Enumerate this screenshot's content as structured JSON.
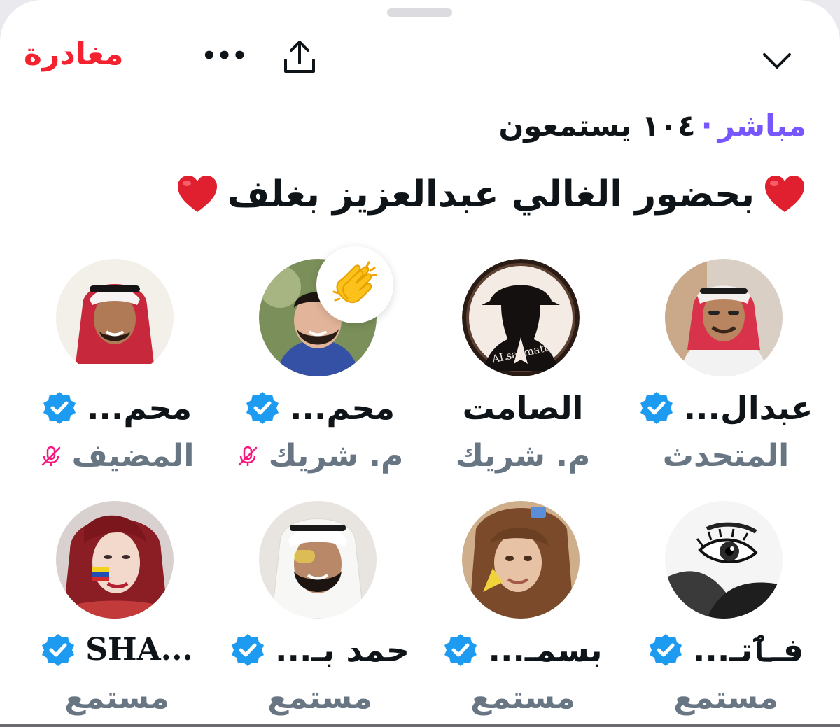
{
  "header": {
    "leave_label": "مغادرة",
    "more_label": "•••",
    "share_icon": "share-icon",
    "collapse_icon": "chevron-down-icon"
  },
  "space": {
    "live_label": "مباشر",
    "listeners_label": "١٠٤ يستمعون",
    "title": "بحضور الغالي عبدالعزيز بغلف",
    "title_icon": "red-heart"
  },
  "participants": [
    {
      "name": "عبدال...",
      "role": "المتحدث",
      "verified": true,
      "muted": false,
      "reaction": ""
    },
    {
      "name": "الصامت",
      "role": "م. شريك",
      "verified": false,
      "muted": false,
      "reaction": "",
      "avatar_text": "ALsaamatt"
    },
    {
      "name": "محم...",
      "role": "م. شريك",
      "verified": true,
      "muted": true,
      "reaction": "clapping-hands"
    },
    {
      "name": "محم...",
      "role": "المضيف",
      "verified": true,
      "muted": true,
      "reaction": ""
    },
    {
      "name": "فـٱتـ...",
      "role": "مستمع",
      "verified": true,
      "muted": false,
      "reaction": ""
    },
    {
      "name": "بسمـ...",
      "role": "مستمع",
      "verified": true,
      "muted": false,
      "reaction": ""
    },
    {
      "name": "حمد بـ...",
      "role": "مستمع",
      "verified": true,
      "muted": false,
      "reaction": ""
    },
    {
      "name": "SHA...",
      "role": "مستمع",
      "verified": true,
      "muted": false,
      "reaction": ""
    }
  ],
  "colors": {
    "leave": "#f4212e",
    "live": "#7856ff",
    "verified": "#1d9bf0",
    "role": "#687684",
    "mic_off": "#f91880"
  }
}
